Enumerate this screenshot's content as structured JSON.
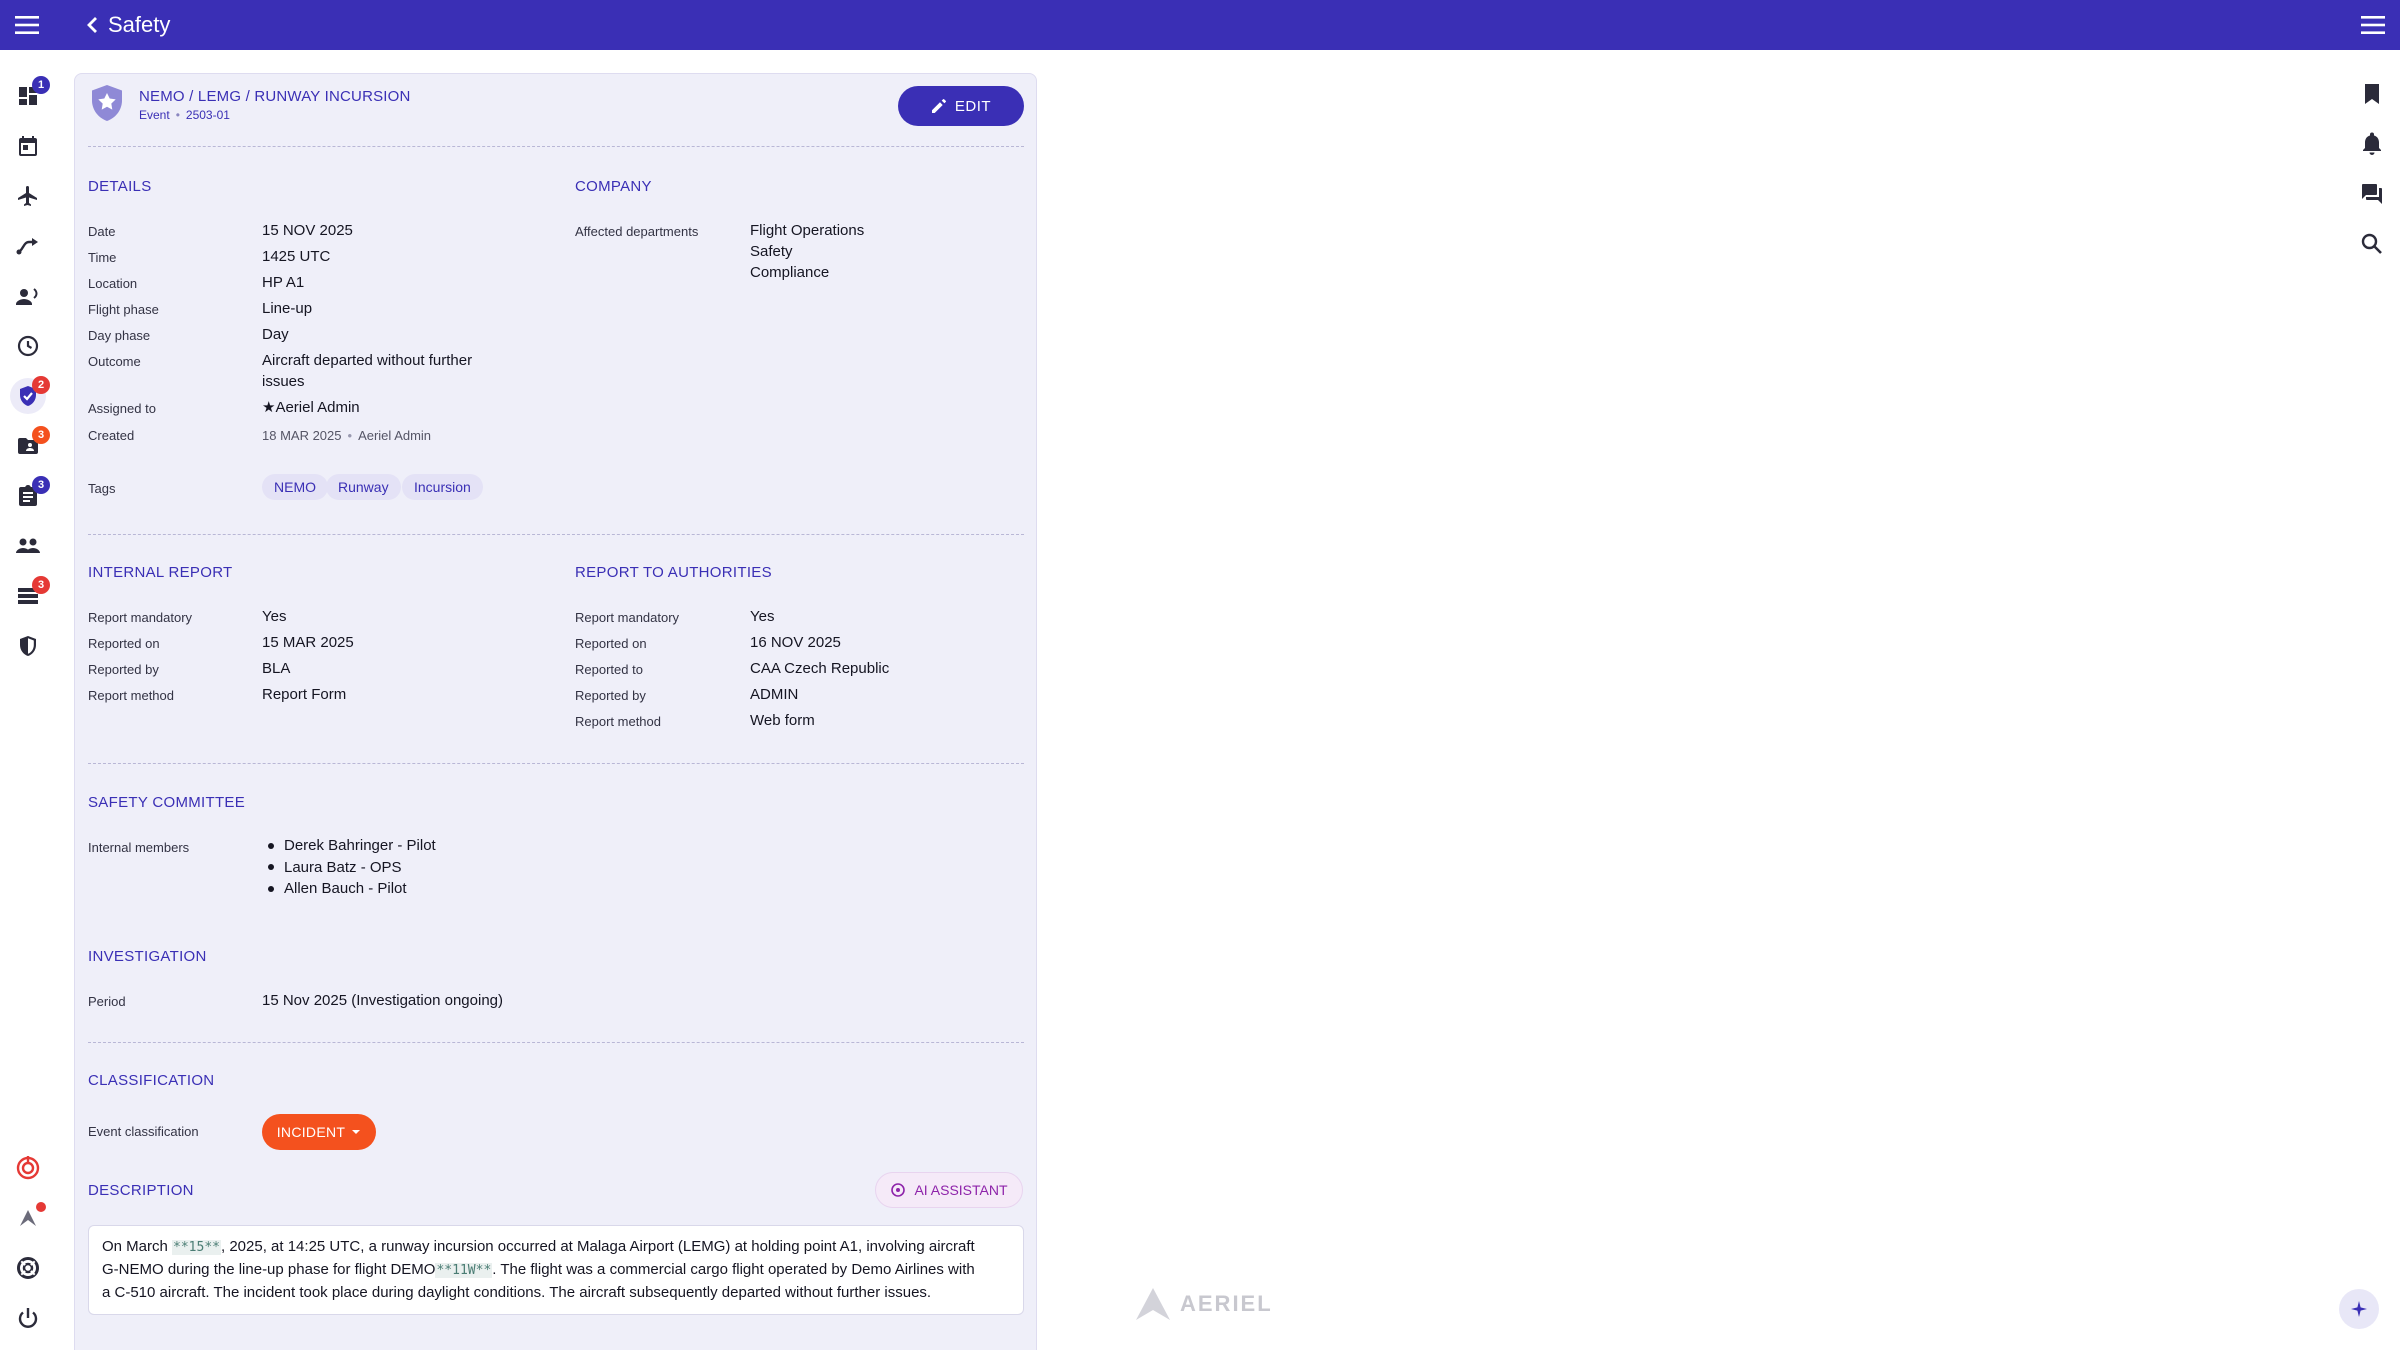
{
  "header": {
    "title": "Safety"
  },
  "sidebar": {
    "badges": {
      "dashboard": "1",
      "safety": "2",
      "contacts": "3",
      "tasks": "3",
      "lists": "3"
    }
  },
  "event": {
    "breadcrumb": "NEMO / LEMG / RUNWAY INCURSION",
    "type": "Event",
    "number": "2503-01",
    "edit_label": "EDIT"
  },
  "details": {
    "heading": "DETAILS",
    "date_label": "Date",
    "date": "15 NOV 2025",
    "time_label": "Time",
    "time": "1425 UTC",
    "location_label": "Location",
    "location": "HP A1",
    "flight_phase_label": "Flight phase",
    "flight_phase": "Line-up",
    "day_phase_label": "Day phase",
    "day_phase": "Day",
    "outcome_label": "Outcome",
    "outcome_line1": "Aircraft departed without further",
    "outcome_line2": "issues",
    "assigned_label": "Assigned to",
    "assigned": "★Aeriel Admin",
    "created_label": "Created",
    "created_date": "18 MAR 2025",
    "created_by": "Aeriel Admin",
    "tags_label": "Tags",
    "tags": [
      "NEMO",
      "Runway",
      "Incursion"
    ]
  },
  "company": {
    "heading": "COMPANY",
    "departments_label": "Affected departments",
    "departments": [
      "Flight Operations",
      "Safety",
      "Compliance"
    ]
  },
  "internal_report": {
    "heading": "INTERNAL REPORT",
    "mandatory_label": "Report mandatory",
    "mandatory": "Yes",
    "reported_on_label": "Reported on",
    "reported_on": "15 MAR 2025",
    "reported_by_label": "Reported by",
    "reported_by": "BLA",
    "method_label": "Report method",
    "method": "Report Form"
  },
  "authorities_report": {
    "heading": "REPORT TO AUTHORITIES",
    "mandatory_label": "Report mandatory",
    "mandatory": "Yes",
    "reported_on_label": "Reported on",
    "reported_on": "16 NOV 2025",
    "reported_to_label": "Reported to",
    "reported_to": "CAA Czech Republic",
    "reported_by_label": "Reported by",
    "reported_by": "ADMIN",
    "method_label": "Report method",
    "method": "Web form"
  },
  "committee": {
    "heading": "SAFETY COMMITTEE",
    "members_label": "Internal members",
    "members": [
      "Derek Bahringer - Pilot",
      "Laura Batz - OPS",
      "Allen Bauch - Pilot"
    ]
  },
  "investigation": {
    "heading": "INVESTIGATION",
    "period_label": "Period",
    "period": "15 Nov 2025 (Investigation ongoing)"
  },
  "classification": {
    "heading": "CLASSIFICATION",
    "label": "Event classification",
    "value": "INCIDENT"
  },
  "description": {
    "heading": "DESCRIPTION",
    "ai_label": "AI ASSISTANT",
    "t1": "On March ",
    "m1": "**15**",
    "t2": ", 2025, at 14:25 UTC, a runway incursion occurred at Malaga Airport (LEMG) at holding point A1, involving aircraft",
    "t3": "G-NEMO during the line-up phase for flight DEMO",
    "m2": "**11W**",
    "t4": ". The flight was a commercial cargo flight operated by Demo Airlines with",
    "t5": "a C-510 aircraft. The incident took place during daylight conditions. The aircraft subsequently departed without further issues."
  },
  "watermark": "AERIEL",
  "colors": {
    "primary": "#3a2fb5",
    "badge_red": "#e53935",
    "incident": "#f4511e",
    "ai": "#8e24aa"
  }
}
